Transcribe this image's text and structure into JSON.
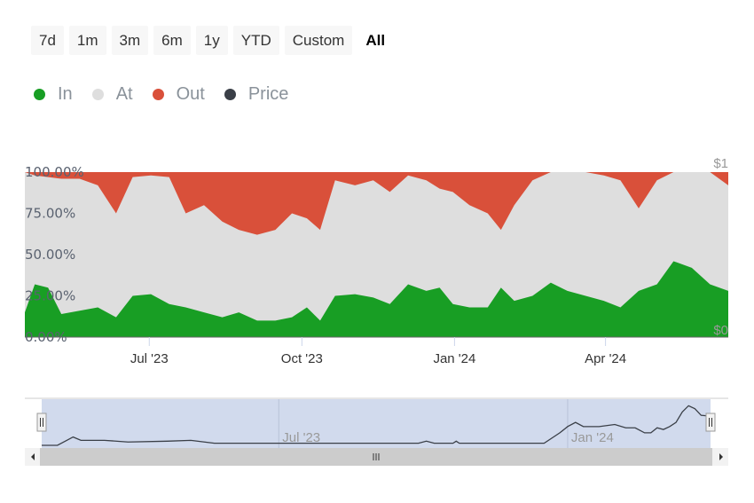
{
  "range_buttons": [
    "7d",
    "1m",
    "3m",
    "6m",
    "1y",
    "YTD",
    "Custom",
    "All"
  ],
  "active_range": "All",
  "legend": [
    {
      "name": "In",
      "color": "#189e24"
    },
    {
      "name": "At",
      "color": "#dedede"
    },
    {
      "name": "Out",
      "color": "#d9503a"
    },
    {
      "name": "Price",
      "color": "#3a3f47"
    }
  ],
  "chart_data": {
    "type": "area",
    "x_unit": "days since 2023-04-17",
    "x_range": [
      0,
      424
    ],
    "yaxis_labels": [
      "100.00%",
      "75.00%",
      "50.00%",
      "25.00%",
      "0.00%"
    ],
    "ylim": [
      0,
      100
    ],
    "price_axis_labels": [
      "$1",
      "$0"
    ],
    "price_lim": [
      0,
      1
    ],
    "x_ticks": [
      {
        "label": "Jul '23",
        "day": 75
      },
      {
        "label": "Oct '23",
        "day": 167
      },
      {
        "label": "Jan '24",
        "day": 259
      },
      {
        "label": "Apr '24",
        "day": 350
      }
    ],
    "days": [
      0,
      6,
      14,
      22,
      33,
      44,
      55,
      65,
      76,
      87,
      97,
      108,
      119,
      129,
      140,
      151,
      161,
      170,
      178,
      187,
      199,
      210,
      220,
      231,
      242,
      250,
      258,
      268,
      279,
      287,
      295,
      306,
      317,
      327,
      338,
      349,
      359,
      370,
      381,
      391,
      402,
      413,
      424
    ],
    "series": [
      {
        "name": "In",
        "values": [
          15,
          32,
          30,
          14,
          16,
          18,
          12,
          25,
          26,
          20,
          18,
          15,
          12,
          15,
          10,
          10,
          12,
          18,
          10,
          25,
          26,
          24,
          20,
          32,
          28,
          30,
          20,
          18,
          18,
          30,
          22,
          25,
          33,
          28,
          25,
          22,
          18,
          28,
          32,
          46,
          42,
          32,
          28
        ]
      },
      {
        "name": "Out",
        "values": [
          0,
          2,
          3,
          4,
          4,
          8,
          25,
          3,
          2,
          3,
          25,
          20,
          30,
          35,
          38,
          35,
          25,
          28,
          35,
          5,
          8,
          5,
          12,
          2,
          5,
          10,
          12,
          20,
          25,
          35,
          20,
          5,
          0,
          0,
          0,
          2,
          5,
          22,
          5,
          0,
          0,
          0,
          8
        ]
      }
    ],
    "navigator": {
      "x_ticks": [
        {
          "label": "Jul '23",
          "day": 75
        },
        {
          "label": "Jan '24",
          "day": 259
        }
      ],
      "price_days": [
        0,
        10,
        15,
        20,
        25,
        40,
        55,
        80,
        95,
        110,
        240,
        245,
        250,
        262,
        264,
        266,
        320,
        330,
        335,
        340,
        345,
        355,
        365,
        372,
        378,
        384,
        388,
        392,
        396,
        400,
        404,
        408,
        412,
        416,
        420,
        426
      ],
      "price_values": [
        0,
        0,
        0.1,
        0.2,
        0.12,
        0.12,
        0.08,
        0.1,
        0.12,
        0.05,
        0.05,
        0.1,
        0.05,
        0.05,
        0.1,
        0.05,
        0.05,
        0.3,
        0.45,
        0.55,
        0.45,
        0.45,
        0.5,
        0.42,
        0.42,
        0.3,
        0.3,
        0.42,
        0.38,
        0.45,
        0.55,
        0.8,
        0.95,
        0.88,
        0.72,
        0.7
      ]
    }
  }
}
